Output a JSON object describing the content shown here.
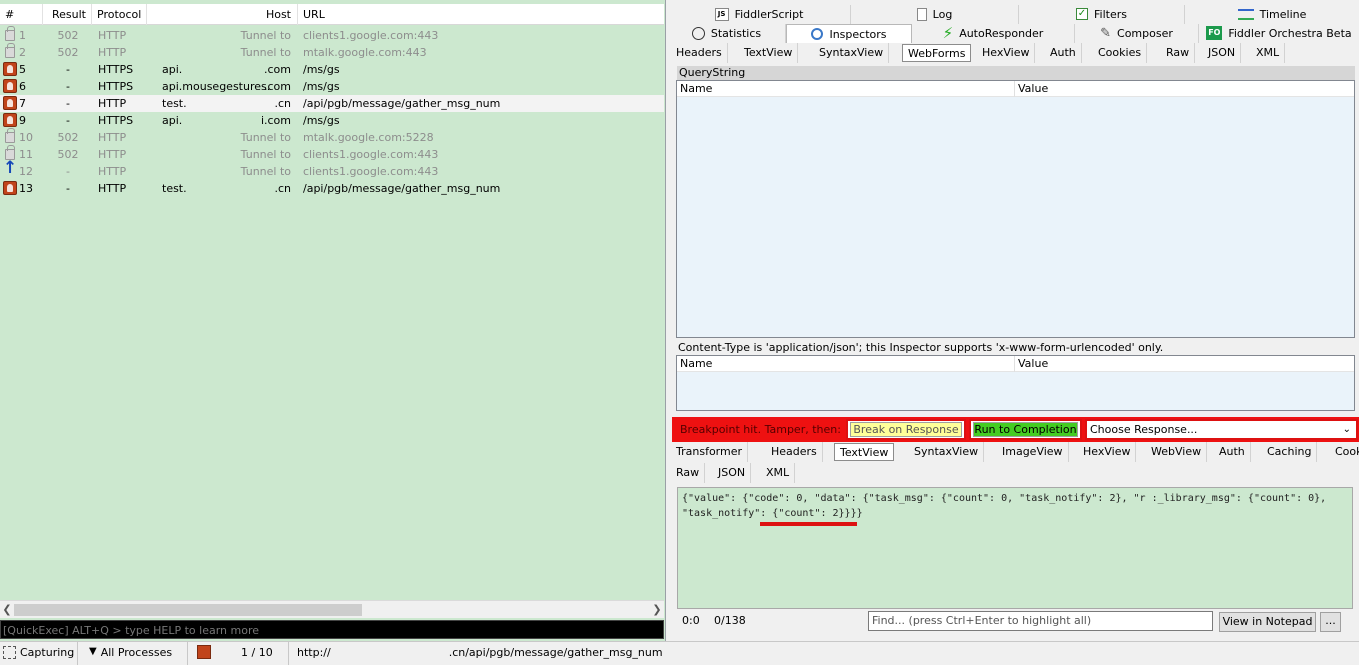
{
  "sessions": {
    "headers": {
      "num": "#",
      "result": "Result",
      "protocol": "Protocol",
      "host": "Host",
      "url": "URL"
    },
    "rows": [
      {
        "icon": "lock-icon",
        "num": "1",
        "result": "502",
        "protocol": "HTTP",
        "host": "Tunnel to",
        "url": "clients1.google.com:443",
        "style": "dim"
      },
      {
        "icon": "lock-icon",
        "num": "2",
        "result": "502",
        "protocol": "HTTP",
        "host": "Tunnel to",
        "url": "mtalk.google.com:443",
        "style": "dim"
      },
      {
        "icon": "breakpoint-icon",
        "num": "5",
        "result": "-",
        "protocol": "HTTPS",
        "host_prefix": "api.",
        "host_suffix": ".com",
        "url": "/ms/gs",
        "style": ""
      },
      {
        "icon": "breakpoint-icon",
        "num": "6",
        "result": "-",
        "protocol": "HTTPS",
        "host_prefix": "api.mousegestures.",
        "host_suffix": ".com",
        "url": "/ms/gs",
        "style": ""
      },
      {
        "icon": "breakpoint-icon",
        "num": "7",
        "result": "-",
        "protocol": "HTTP",
        "host_prefix": "test.",
        "host_suffix": ".cn",
        "url": "/api/pgb/message/gather_msg_num",
        "style": "sel"
      },
      {
        "icon": "breakpoint-icon",
        "num": "9",
        "result": "-",
        "protocol": "HTTPS",
        "host_prefix": "api.",
        "host_suffix": "i.com",
        "url": "/ms/gs",
        "style": ""
      },
      {
        "icon": "lock-icon",
        "num": "10",
        "result": "502",
        "protocol": "HTTP",
        "host": "Tunnel to",
        "url": "mtalk.google.com:5228",
        "style": "dim"
      },
      {
        "icon": "lock-icon",
        "num": "11",
        "result": "502",
        "protocol": "HTTP",
        "host": "Tunnel to",
        "url": "clients1.google.com:443",
        "style": "dim"
      },
      {
        "icon": "upload-arrow-icon",
        "num": "12",
        "result": "-",
        "protocol": "HTTP",
        "host": "Tunnel to",
        "url": "clients1.google.com:443",
        "style": "dim"
      },
      {
        "icon": "breakpoint-icon",
        "num": "13",
        "result": "-",
        "protocol": "HTTP",
        "host_prefix": "test.",
        "host_suffix": ".cn",
        "url": "/api/pgb/message/gather_msg_num",
        "style": ""
      }
    ]
  },
  "quickexec": {
    "placeholder": "[QuickExec] ALT+Q > type HELP to learn more"
  },
  "top_tabs_row1": {
    "fiddlerscript": "FiddlerScript",
    "log": "Log",
    "filters": "Filters",
    "timeline": "Timeline"
  },
  "top_tabs_row2": {
    "statistics": "Statistics",
    "inspectors": "Inspectors",
    "autoresponder": "AutoResponder",
    "composer": "Composer",
    "orchestra": "Fiddler Orchestra Beta",
    "orchestra_badge": "FO"
  },
  "request_tabs": [
    "Headers",
    "TextView",
    "SyntaxView",
    "WebForms",
    "HexView",
    "Auth",
    "Cookies",
    "Raw",
    "JSON",
    "XML"
  ],
  "request_active_tab": "WebForms",
  "webforms": {
    "querystring_label": "QueryString",
    "col_name": "Name",
    "col_value": "Value",
    "content_type_msg": "Content-Type is 'application/json'; this Inspector supports 'x-www-form-urlencoded' only.",
    "col_name2": "Name",
    "col_value2": "Value"
  },
  "breakpoint_bar": {
    "label": "Breakpoint hit. Tamper, then:",
    "break_on_response": "Break on Response",
    "run_to_completion": "Run to Completion",
    "choose_response": "Choose Response..."
  },
  "response_tabs_row1": [
    "Transformer",
    "Headers",
    "TextView",
    "SyntaxView",
    "ImageView",
    "HexView",
    "WebView",
    "Auth",
    "Caching",
    "Cookies"
  ],
  "response_tabs_row2": [
    "Raw",
    "JSON",
    "XML"
  ],
  "response_active_tab": "TextView",
  "response_text": "{\"value\": {\"code\": 0, \"data\": {\"task_msg\": {\"count\": 0, \"task_notify\": 2}, \"r :_library_msg\": {\"count\": 0},\n\"task_notify\": {\"count\": 2}}}}",
  "response_footer": {
    "position": "0:0",
    "length": "0/138",
    "find_placeholder": "Find... (press Ctrl+Enter to highlight all)",
    "view_in_notepad": "View in Notepad",
    "more": "..."
  },
  "status_bar": {
    "capturing": "Capturing",
    "processes": "All Processes",
    "count": "1 / 10",
    "url_prefix": "http://",
    "url_suffix": ".cn/api/pgb/message/gather_msg_num"
  },
  "colors": {
    "session_bg": "#cce8cf",
    "breakpoint_red": "#ee1111",
    "run_green": "#44cc22",
    "break_yellow": "#ffff99",
    "annotation_red": "#dd1111"
  }
}
